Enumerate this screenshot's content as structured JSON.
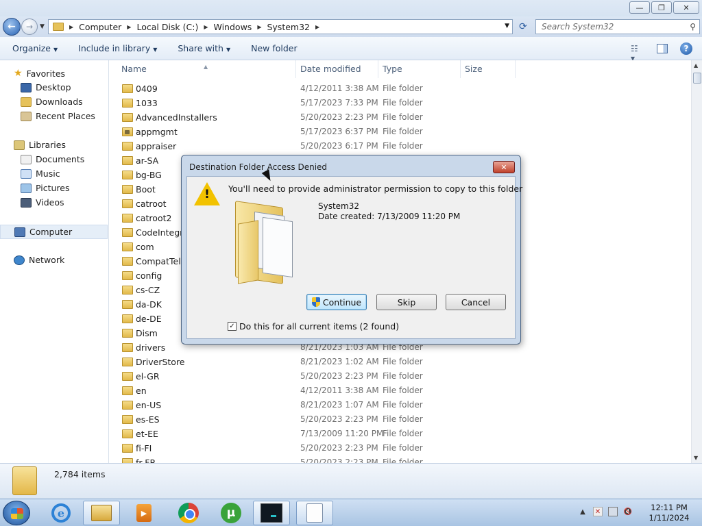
{
  "window": {
    "minimize": "—",
    "maximize": "❐",
    "close": "✕"
  },
  "address": {
    "crumbs": [
      "Computer",
      "Local Disk (C:)",
      "Windows",
      "System32"
    ]
  },
  "search": {
    "placeholder": "Search System32"
  },
  "toolbar": {
    "organize": "Organize",
    "include_in_library": "Include in library",
    "share_with": "Share with",
    "new_folder": "New folder"
  },
  "nav": {
    "favorites": "Favorites",
    "desktop": "Desktop",
    "downloads": "Downloads",
    "recent_places": "Recent Places",
    "libraries": "Libraries",
    "documents": "Documents",
    "music": "Music",
    "pictures": "Pictures",
    "videos": "Videos",
    "computer": "Computer",
    "network": "Network"
  },
  "columns": {
    "name": "Name",
    "date_modified": "Date modified",
    "type": "Type",
    "size": "Size"
  },
  "files": [
    {
      "name": "0409",
      "date": "4/12/2011 3:38 AM",
      "type": "File folder"
    },
    {
      "name": "1033",
      "date": "5/17/2023 7:33 PM",
      "type": "File folder"
    },
    {
      "name": "AdvancedInstallers",
      "date": "5/20/2023 2:23 PM",
      "type": "File folder"
    },
    {
      "name": "appmgmt",
      "date": "5/17/2023 6:37 PM",
      "type": "File folder",
      "locked": true
    },
    {
      "name": "appraiser",
      "date": "5/20/2023 6:17 PM",
      "type": "File folder"
    },
    {
      "name": "ar-SA",
      "date": "",
      "type": ""
    },
    {
      "name": "bg-BG",
      "date": "",
      "type": ""
    },
    {
      "name": "Boot",
      "date": "",
      "type": ""
    },
    {
      "name": "catroot",
      "date": "",
      "type": ""
    },
    {
      "name": "catroot2",
      "date": "",
      "type": ""
    },
    {
      "name": "CodeIntegrit",
      "date": "",
      "type": ""
    },
    {
      "name": "com",
      "date": "",
      "type": ""
    },
    {
      "name": "CompatTel",
      "date": "",
      "type": ""
    },
    {
      "name": "config",
      "date": "",
      "type": ""
    },
    {
      "name": "cs-CZ",
      "date": "",
      "type": ""
    },
    {
      "name": "da-DK",
      "date": "",
      "type": ""
    },
    {
      "name": "de-DE",
      "date": "",
      "type": ""
    },
    {
      "name": "Dism",
      "date": "",
      "type": ""
    },
    {
      "name": "drivers",
      "date": "8/21/2023 1:03 AM",
      "type": "File folder"
    },
    {
      "name": "DriverStore",
      "date": "8/21/2023 1:02 AM",
      "type": "File folder"
    },
    {
      "name": "el-GR",
      "date": "5/20/2023 2:23 PM",
      "type": "File folder"
    },
    {
      "name": "en",
      "date": "4/12/2011 3:38 AM",
      "type": "File folder"
    },
    {
      "name": "en-US",
      "date": "8/21/2023 1:07 AM",
      "type": "File folder"
    },
    {
      "name": "es-ES",
      "date": "5/20/2023 2:23 PM",
      "type": "File folder"
    },
    {
      "name": "et-EE",
      "date": "7/13/2009 11:20 PM",
      "type": "File folder"
    },
    {
      "name": "fi-FI",
      "date": "5/20/2023 2:23 PM",
      "type": "File folder"
    },
    {
      "name": "fr-FR",
      "date": "5/20/2023 2:23 PM",
      "type": "File folder"
    }
  ],
  "status": {
    "item_count": "2,784 items"
  },
  "dialog": {
    "title": "Destination Folder Access Denied",
    "close": "✕",
    "message": "You'll need to provide administrator permission to copy to this folder",
    "folder_name": "System32",
    "date_created": "Date created: 7/13/2009 11:20 PM",
    "continue": "Continue",
    "skip": "Skip",
    "cancel": "Cancel",
    "checkbox_label": "Do this for all current items (2 found)",
    "checkbox_checked": true
  },
  "taskbar": {
    "time": "12:11 PM",
    "date": "1/11/2024"
  }
}
